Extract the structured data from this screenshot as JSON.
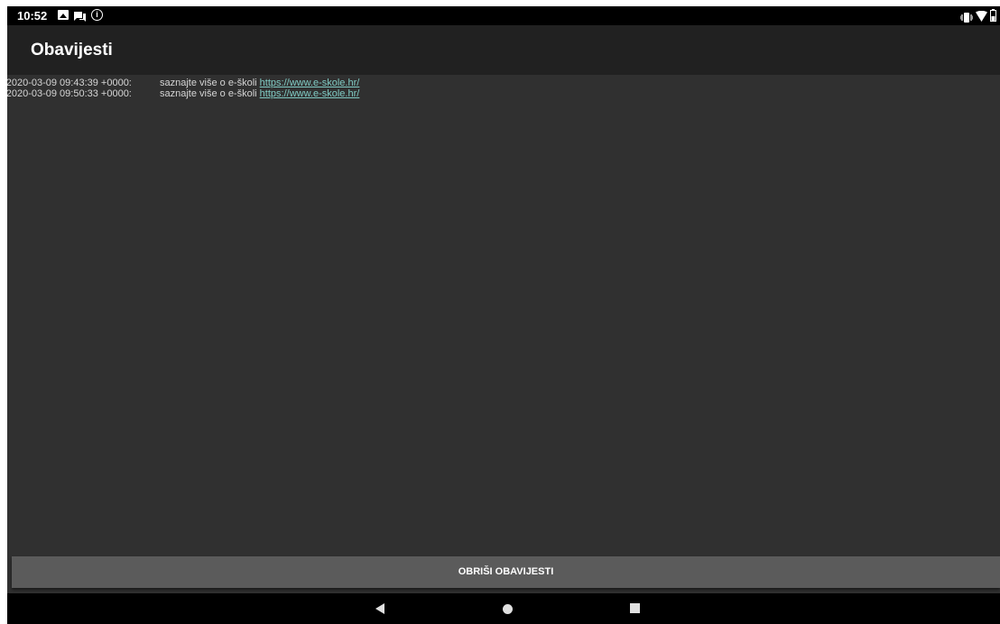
{
  "status_bar": {
    "time": "10:52",
    "icons": [
      "image-notification-icon",
      "chat-notification-icon",
      "info-icon",
      "vibrate-icon",
      "wifi-icon",
      "battery-icon"
    ]
  },
  "app_bar": {
    "title": "Obavijesti"
  },
  "notifications": [
    {
      "timestamp": "- 2020-03-09 09:43:39 +0000:",
      "text": "saznajte više o e-školi",
      "link": "https://www.e-skole.hr/"
    },
    {
      "timestamp": "- 2020-03-09 09:50:33 +0000:",
      "text": "saznajte više o e-školi",
      "link": "https://www.e-skole.hr/"
    }
  ],
  "clear_button": {
    "label": "OBRIŠI OBAVIJESTI"
  },
  "nav_bar": {
    "icons": [
      "back-icon",
      "home-icon",
      "recents-icon"
    ]
  },
  "colors": {
    "background": "#303030",
    "app_bar": "#212121",
    "link": "#80cbc4",
    "button": "#5b5b5b"
  }
}
